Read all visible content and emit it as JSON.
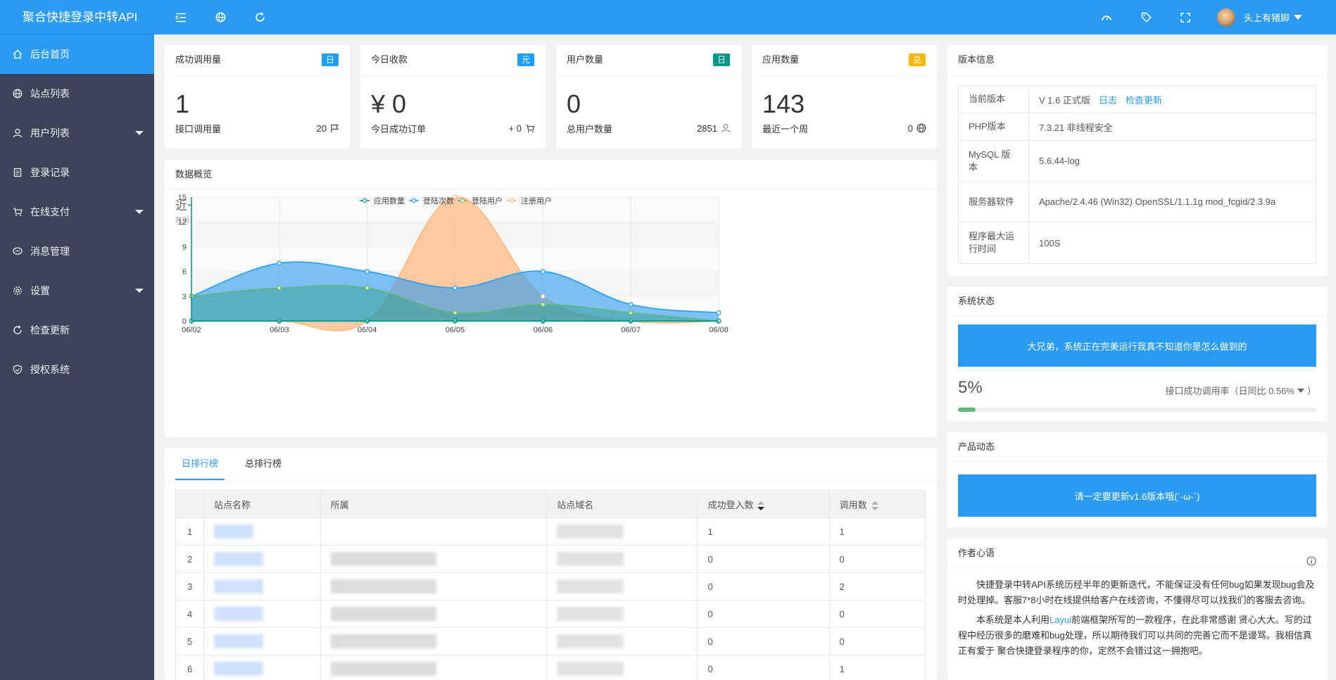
{
  "app": {
    "title": "聚合快捷登录中转API"
  },
  "sidebar": {
    "items": [
      {
        "label": "后台首页",
        "icon": "home-icon",
        "active": true
      },
      {
        "label": "站点列表",
        "icon": "globe-icon"
      },
      {
        "label": "用户列表",
        "icon": "user-icon",
        "expandable": true
      },
      {
        "label": "登录记录",
        "icon": "document-icon"
      },
      {
        "label": "在线支付",
        "icon": "cart-icon",
        "expandable": true
      },
      {
        "label": "消息管理",
        "icon": "message-icon"
      },
      {
        "label": "设置",
        "icon": "gear-icon",
        "expandable": true
      },
      {
        "label": "检查更新",
        "icon": "refresh-icon"
      },
      {
        "label": "授权系统",
        "icon": "shield-icon"
      }
    ]
  },
  "topbar": {
    "user_name": "头上有猪脚"
  },
  "stats": [
    {
      "title": "成功调用量",
      "badge": "日",
      "badge_color": "#1e9fff",
      "value": "1",
      "foot_label": "接口调用量",
      "foot_value": "20",
      "foot_icon": "flag-icon"
    },
    {
      "title": "今日收款",
      "badge": "元",
      "badge_color": "#1e9fff",
      "value": "¥ 0",
      "foot_label": "今日成功订单",
      "foot_value": "+ 0",
      "foot_icon": "cart-icon"
    },
    {
      "title": "用户数量",
      "badge": "日",
      "badge_color": "#009688",
      "value": "0",
      "foot_label": "总用户数量",
      "foot_value": "2851",
      "foot_icon": "user-icon"
    },
    {
      "title": "应用数量",
      "badge": "总",
      "badge_color": "#ffb800",
      "value": "143",
      "foot_label": "最近一个周",
      "foot_value": "0",
      "foot_icon": "globe-icon"
    }
  ],
  "overview": {
    "title": "数据概览"
  },
  "chart_data": {
    "type": "area",
    "title": "近一周数据统计",
    "subtitle": "数据来源数据库实时更新",
    "x": [
      "06/02",
      "06/03",
      "06/04",
      "06/05",
      "06/06",
      "06/07",
      "06/08"
    ],
    "ylim": [
      0,
      15
    ],
    "yticks": [
      0,
      3,
      6,
      9,
      12,
      15
    ],
    "legend_position": "top-center",
    "series": [
      {
        "name": "应用数量",
        "color": "#009688",
        "values": [
          0,
          0,
          0,
          0,
          0,
          0,
          0
        ]
      },
      {
        "name": "登陆次数",
        "color": "#1e9fff",
        "values": [
          3,
          7,
          6,
          4,
          6,
          2,
          1
        ]
      },
      {
        "name": "登陆用户",
        "color": "#5fb878",
        "values": [
          3,
          4,
          4,
          1,
          2,
          1,
          0
        ]
      },
      {
        "name": "注册用户",
        "color": "#ffb980",
        "values": [
          0,
          0,
          0,
          15,
          3,
          0,
          0
        ]
      }
    ]
  },
  "ranking": {
    "tabs": [
      "日排行榜",
      "总排行榜"
    ],
    "columns": [
      "站点名称",
      "所属",
      "站点域名",
      "成功登入数",
      "调用数"
    ],
    "rows": [
      {
        "n": "1",
        "success": "1",
        "calls": "1"
      },
      {
        "n": "2",
        "success": "0",
        "calls": "0"
      },
      {
        "n": "3",
        "success": "0",
        "calls": "2"
      },
      {
        "n": "4",
        "success": "0",
        "calls": "0"
      },
      {
        "n": "5",
        "success": "0",
        "calls": "0"
      },
      {
        "n": "6",
        "success": "0",
        "calls": "1"
      }
    ]
  },
  "version": {
    "title": "版本信息",
    "current_label": "当前版本",
    "current_value": "V 1.6 正式版",
    "log_link": "日志",
    "update_link": "检查更新",
    "php_label": "PHP版本",
    "php_value": "7.3.21 非线程安全",
    "mysql_label": "MySQL 版本",
    "mysql_value": "5.6.44-log",
    "server_label": "服务器软件",
    "server_value": "Apache/2.4.46 (Win32) OpenSSL/1.1.1g mod_fcgid/2.3.9a",
    "runtime_label": "程序最大运行时间",
    "runtime_value": "100S"
  },
  "system": {
    "title": "系统状态",
    "message": "大兄弟，系统正在完美运行我真不知道你是怎么做到的",
    "percent": "5%",
    "progress": 0.05,
    "rate_label": "接口成功调用率（日同比 0.56%"
  },
  "product": {
    "title": "产品动态",
    "message": "请一定要更新v1.6版本哦(`-ω-´)"
  },
  "author": {
    "title": "作者心语",
    "p1": "快捷登录中转API系统历经半年的更新迭代，不能保证没有任何bug如果发现bug会及时处理掉。客服7*8小时在线提供给客户在线咨询，不懂得尽可以找我们的客服去咨询。",
    "p2_a": "本系统是本人利用",
    "p2_link": "Layui",
    "p2_b": "前端框架所写的一款程序，在此非常感谢 贤心大大。写的过程中经历很多的磨难和bug处理，所以期待我们可以共同的完善它而不是谩骂。我相信真正有爱于 聚合快捷登录程序的你，定然不会错过这一拥抱吧。"
  }
}
